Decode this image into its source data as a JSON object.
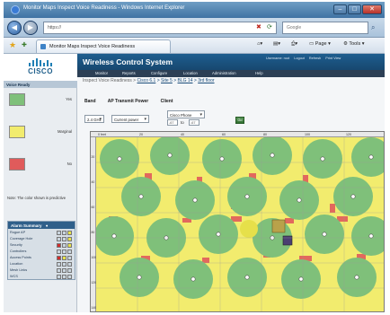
{
  "browser": {
    "window_title": "Monitor Maps Inspect Voice Readiness - Windows Internet Explorer",
    "address": "https://",
    "search_placeholder": "Google",
    "tab_label": "Monitor Maps Inspect Voice Readiness",
    "commands": {
      "page": "Page",
      "tools": "Tools"
    }
  },
  "sidebar": {
    "logo_text": "CISCO",
    "legend_title": "Voice Ready",
    "legend": [
      {
        "label": "Yes",
        "color": "#7fc07a"
      },
      {
        "label": "Marginal",
        "color": "#f2ec6e"
      },
      {
        "label": "No",
        "color": "#e05b5b"
      }
    ],
    "note": "Note: The color shown is predictive",
    "alarm_summary": {
      "title": "Alarm Summary",
      "rows": [
        {
          "label": "Rogue AP",
          "cells": [
            "#c9d4dd",
            "#c9d4dd",
            "#e8e24a"
          ]
        },
        {
          "label": "Coverage Hole",
          "cells": [
            "#c9d4dd",
            "#c9d4dd",
            "#e8e24a"
          ]
        },
        {
          "label": "Security",
          "cells": [
            "#d02c2c",
            "#c9d4dd",
            "#e8e24a"
          ]
        },
        {
          "label": "Controllers",
          "cells": [
            "#c9d4dd",
            "#c9d4dd",
            "#c9d4dd"
          ]
        },
        {
          "label": "Access Points",
          "cells": [
            "#d02c2c",
            "#e8e24a",
            "#c9d4dd"
          ]
        },
        {
          "label": "Location",
          "cells": [
            "#c9d4dd",
            "#c9d4dd",
            "#c9d4dd"
          ]
        },
        {
          "label": "Mesh Links",
          "cells": [
            "#c9d4dd",
            "#c9d4dd",
            "#c9d4dd"
          ]
        },
        {
          "label": "WCS",
          "cells": [
            "#c9d4dd",
            "#c9d4dd",
            "#c9d4dd"
          ]
        }
      ]
    }
  },
  "app": {
    "title": "Wireless Control System",
    "util_links": [
      "Username: root",
      "Logout",
      "Refresh",
      "Print View"
    ],
    "menu": [
      "Monitor",
      "Reports",
      "Configure",
      "Location",
      "Administration",
      "Help"
    ],
    "breadcrumb": {
      "prefix": "Inspect Voice Readiness > ",
      "links": [
        "Cisco 6.1",
        "Site 5",
        "BLG 14",
        "3rd floor"
      ]
    },
    "subtabs": [
      "Band",
      "AP Transmit Power",
      "Client"
    ],
    "filters": {
      "band": "2.4 GHz",
      "power": "Current power",
      "client": "Cisco Phone",
      "range_from": "-67",
      "range_to": "-67",
      "to_label": "to",
      "go_label": "Go"
    },
    "ruler_x": [
      "0 feet",
      "20",
      "40",
      "60",
      "80",
      "100",
      "120",
      "140"
    ],
    "ruler_y": [
      "20",
      "40",
      "60",
      "80",
      "100",
      "120",
      "140"
    ]
  }
}
